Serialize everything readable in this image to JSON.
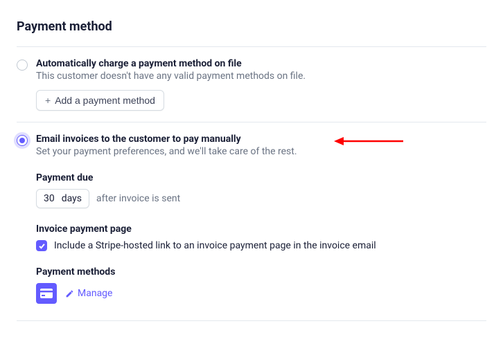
{
  "section_title": "Payment method",
  "option_auto": {
    "title": "Automatically charge a payment method on file",
    "desc": "This customer doesn't have any valid payment methods on file.",
    "add_button": "Add a payment method"
  },
  "option_email": {
    "title": "Email invoices to the customer to pay manually",
    "desc": "Set your payment preferences, and we'll take care of the rest."
  },
  "payment_due": {
    "label": "Payment due",
    "value": "30",
    "unit": "days",
    "suffix": "after invoice is sent"
  },
  "invoice_page": {
    "label": "Invoice payment page",
    "checkbox_label": "Include a Stripe-hosted link to an invoice payment page in the invoice email"
  },
  "payment_methods": {
    "label": "Payment methods",
    "manage": "Manage"
  }
}
